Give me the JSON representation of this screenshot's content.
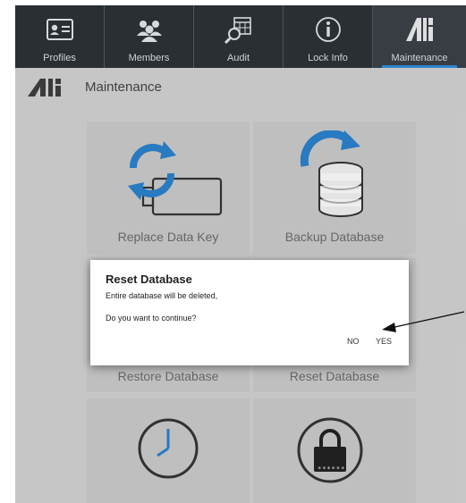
{
  "nav": {
    "items": [
      {
        "label": "Profiles",
        "icon": "profile-card-icon"
      },
      {
        "label": "Members",
        "icon": "members-icon"
      },
      {
        "label": "Audit",
        "icon": "audit-icon"
      },
      {
        "label": "Lock Info",
        "icon": "info-icon"
      },
      {
        "label": "Maintenance",
        "icon": "maintenance-logo-icon",
        "active": true
      }
    ]
  },
  "page": {
    "title": "Maintenance"
  },
  "tiles": [
    {
      "label": "Replace Data Key",
      "icon": "refresh-key-icon"
    },
    {
      "label": "Backup Database",
      "icon": "backup-database-icon"
    },
    {
      "label": "Restore Database",
      "icon": "restore-database-icon"
    },
    {
      "label": "Reset Database",
      "icon": "reset-database-icon"
    },
    {
      "label": "",
      "icon": "clock-icon"
    },
    {
      "label": "",
      "icon": "password-lock-icon",
      "badge": "******"
    }
  ],
  "dialog": {
    "title": "Reset Database",
    "line1": "Entire database will be deleted,",
    "line2": "Do you want to continue?",
    "no_label": "NO",
    "yes_label": "YES"
  },
  "colors": {
    "accent": "#2f8bd5",
    "topbar": "#2b3136"
  }
}
